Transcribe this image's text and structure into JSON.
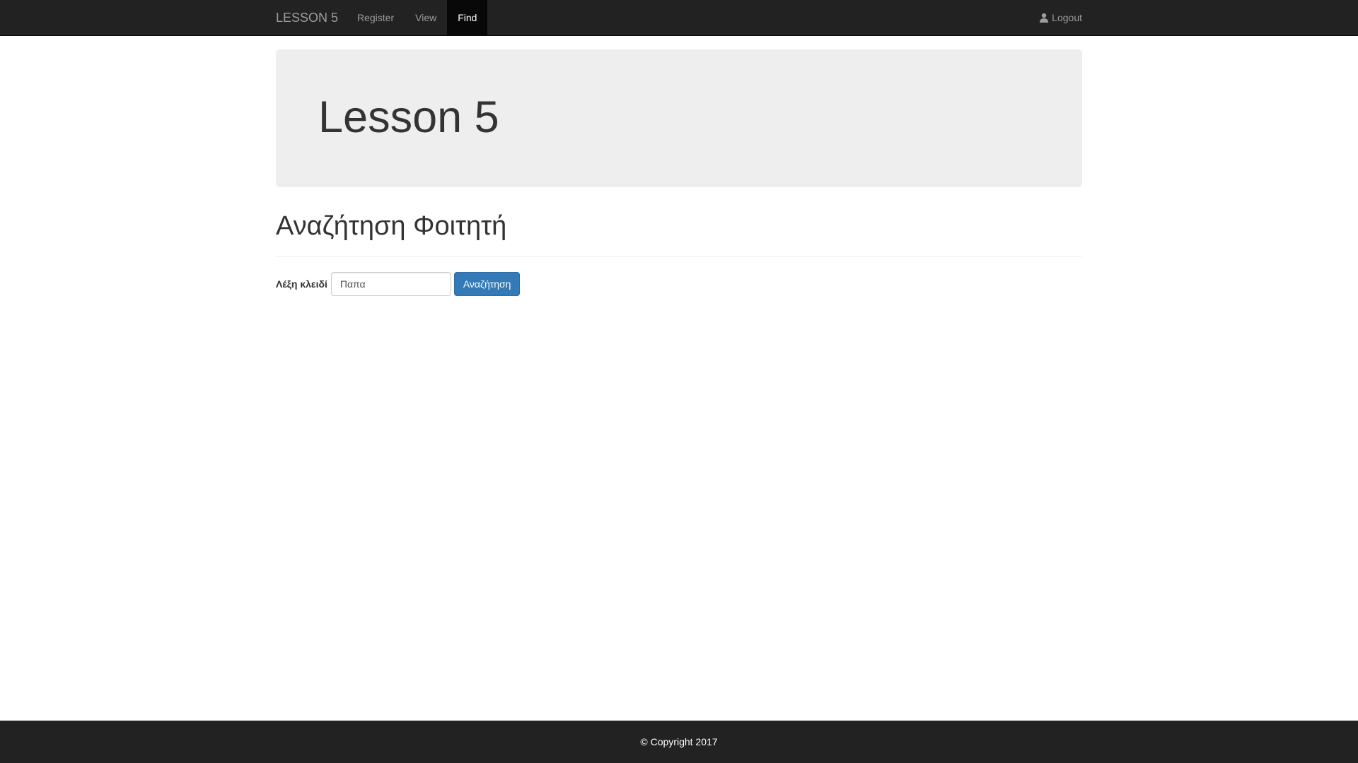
{
  "navbar": {
    "brand": "LESSON 5",
    "links": [
      {
        "label": "Register",
        "active": false
      },
      {
        "label": "View",
        "active": false
      },
      {
        "label": "Find",
        "active": true
      }
    ],
    "logout_label": "Logout",
    "logout_icon": "user-icon"
  },
  "jumbotron": {
    "title": "Lesson 5"
  },
  "main": {
    "heading": "Αναζήτηση Φοιτητή",
    "search": {
      "label": "Λέξη κλειδί",
      "value": "Παπα",
      "button_label": "Αναζήτηση"
    }
  },
  "footer": {
    "copyright": "© Copyright 2017"
  },
  "colors": {
    "navbar_bg": "#222222",
    "jumbotron_bg": "#eeeeee",
    "primary_button": "#337ab7",
    "active_nav_bg": "#080808"
  }
}
